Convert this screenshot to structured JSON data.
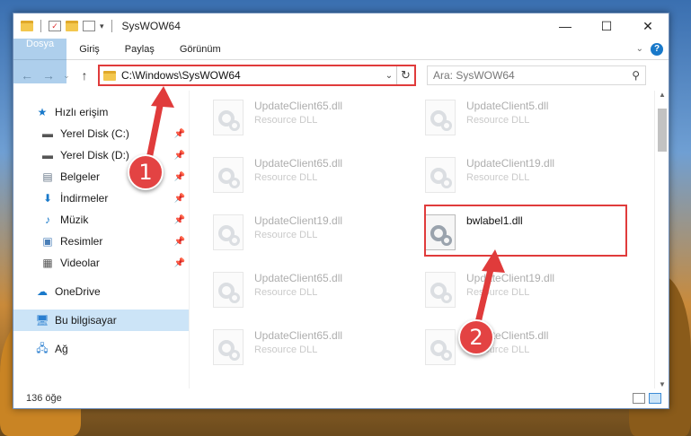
{
  "window": {
    "title": "SysWOW64",
    "controls": [
      "minimize-icon",
      "maximize-icon",
      "close-icon"
    ]
  },
  "ribbon": {
    "tabs": [
      "Dosya",
      "Giriş",
      "Paylaş",
      "Görünüm"
    ]
  },
  "address": {
    "path": "C:\\Windows\\SysWOW64",
    "search_placeholder": "Ara: SysWOW64"
  },
  "sidebar": {
    "quick_access": "Hızlı erişim",
    "items": [
      {
        "label": "Yerel Disk (C:)",
        "icon": "drive-icon",
        "pinned": true
      },
      {
        "label": "Yerel Disk (D:)",
        "icon": "drive-icon",
        "pinned": true
      },
      {
        "label": "Belgeler",
        "icon": "documents-icon",
        "pinned": true
      },
      {
        "label": "İndirmeler",
        "icon": "download-icon",
        "pinned": true
      },
      {
        "label": "Müzik",
        "icon": "music-icon",
        "pinned": true
      },
      {
        "label": "Resimler",
        "icon": "pictures-icon",
        "pinned": true
      },
      {
        "label": "Videolar",
        "icon": "video-icon",
        "pinned": true
      }
    ],
    "onedrive": "OneDrive",
    "this_pc": "Bu bilgisayar",
    "network": "Ağ"
  },
  "files": [
    {
      "name": "UpdateClient65.dll",
      "type": "Resource DLL"
    },
    {
      "name": "UpdateClient5.dll",
      "type": "Resource DLL"
    },
    {
      "name": "UpdateClient65.dll",
      "type": "Resource DLL"
    },
    {
      "name": "UpdateClient19.dll",
      "type": "Resource DLL"
    },
    {
      "name": "UpdateClient19.dll",
      "type": "Resource DLL"
    },
    {
      "name": "bwlabel1.dll",
      "type": ""
    },
    {
      "name": "UpdateClient65.dll",
      "type": "Resource DLL"
    },
    {
      "name": "UpdateClient19.dll",
      "type": "Resource DLL"
    },
    {
      "name": "UpdateClient65.dll",
      "type": "Resource DLL"
    },
    {
      "name": "UpdateClient5.dll",
      "type": "Resource DLL"
    }
  ],
  "status": {
    "count": "136 öğe"
  },
  "callouts": [
    "1",
    "2"
  ],
  "colors": {
    "accent": "#1979ca",
    "highlight": "#e03b3b",
    "selection": "#cce4f7"
  }
}
